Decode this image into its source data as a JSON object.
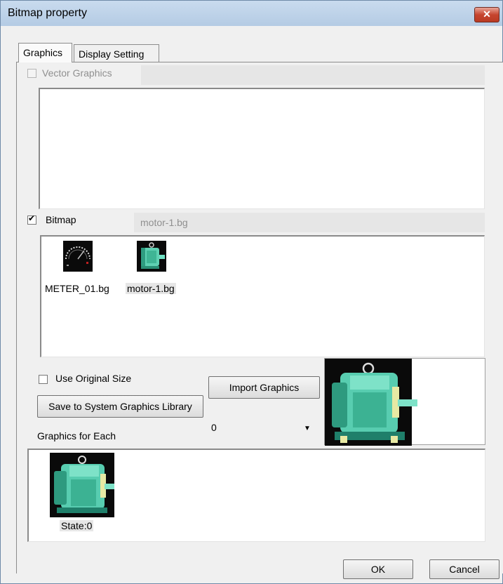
{
  "window": {
    "title": "Bitmap property",
    "close_label": "✕"
  },
  "tabs": [
    {
      "label": "Graphics",
      "active": true
    },
    {
      "label": "Display Setting",
      "active": false
    }
  ],
  "vector": {
    "label": "Vector Graphics",
    "checked": false,
    "enabled": false,
    "name": ""
  },
  "bitmap": {
    "label": "Bitmap",
    "checked": true,
    "name": "motor-1.bg",
    "files": [
      {
        "name": "METER_01.bg",
        "icon": "meter-icon",
        "selected": false
      },
      {
        "name": "motor-1.bg",
        "icon": "motor-icon",
        "selected": true
      }
    ]
  },
  "options": {
    "use_original_size_label": "Use Original Size",
    "use_original_size_checked": false,
    "save_library_label": "Save to System Graphics Library",
    "import_label": "Import Graphics"
  },
  "graphics_for_each": {
    "label": "Graphics for Each",
    "selected_value": "0",
    "states": [
      {
        "label": "State:0",
        "icon": "motor-icon"
      }
    ]
  },
  "footer": {
    "ok_label": "OK",
    "cancel_label": "Cancel"
  },
  "colors": {
    "motor_body": "#4fc6a6",
    "motor_dark": "#1f7f6a"
  }
}
